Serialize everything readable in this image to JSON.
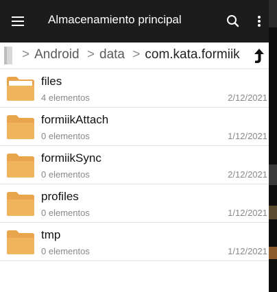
{
  "app_bar": {
    "title": "Almacenamiento principal",
    "menu_icon": "hamburger-menu-icon",
    "search_icon": "search-icon",
    "more_icon": "more-vert-icon",
    "background": "#1c1c1c"
  },
  "breadcrumb": {
    "root_icon": "storage-device-icon",
    "separator": ">",
    "parts": [
      "Android",
      "data",
      "com.kata.formiik"
    ],
    "up_icon": "up-directory-icon"
  },
  "folder_color": "#e8a54c",
  "items": [
    {
      "name": "files",
      "count": "4 elementos",
      "date": "2/12/2021",
      "icon": "folder-open-icon"
    },
    {
      "name": "formiikAttach",
      "count": "0 elementos",
      "date": "1/12/2021",
      "icon": "folder-icon"
    },
    {
      "name": "formiikSync",
      "count": "0 elementos",
      "date": "2/12/2021",
      "icon": "folder-icon"
    },
    {
      "name": "profiles",
      "count": "0 elementos",
      "date": "1/12/2021",
      "icon": "folder-icon"
    },
    {
      "name": "tmp",
      "count": "0 elementos",
      "date": "1/12/2021",
      "icon": "folder-icon"
    }
  ]
}
